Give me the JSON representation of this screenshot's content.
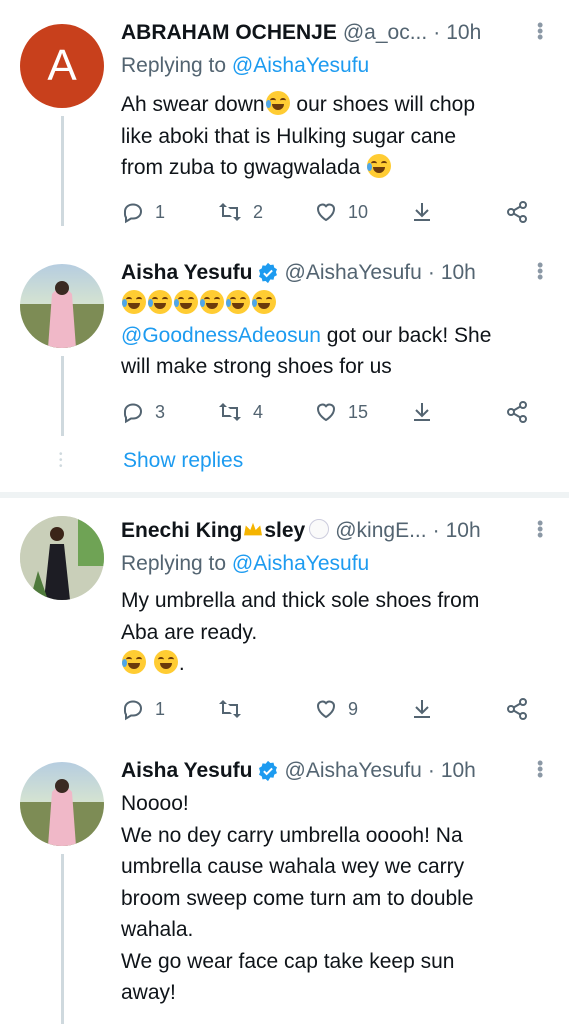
{
  "tweets": [
    {
      "name": "ABRAHAM OCHENJE",
      "handle": "@a_oc...",
      "time": "10h",
      "avatar_letter": "A",
      "replying_prefix": "Replying to ",
      "replying_to": "@AishaYesufu",
      "text_1": "Ah swear down",
      "text_2": " our shoes will chop",
      "text_3": "like aboki that is Hulking sugar cane",
      "text_4": "from zuba to gwagwalada ",
      "replies": "1",
      "retweets": "2",
      "likes": "10"
    },
    {
      "name": "Aisha Yesufu",
      "handle": "@AishaYesufu",
      "time": "10h",
      "mention": "@GoodnessAdeosun",
      "text_1": " got our back! She",
      "text_2": "will make strong shoes for us",
      "replies": "3",
      "retweets": "4",
      "likes": "15"
    },
    {
      "name_part1": "Enechi King",
      "name_part2": "sley",
      "handle": "@kingE...",
      "time": "10h",
      "replying_prefix": "Replying to ",
      "replying_to": "@AishaYesufu",
      "text_1": "My umbrella and thick sole shoes from",
      "text_2": "Aba are ready.",
      "text_3": ".",
      "replies": "1",
      "retweets": "",
      "likes": "9"
    },
    {
      "name": "Aisha Yesufu",
      "handle": "@AishaYesufu",
      "time": "10h",
      "lines": [
        "Noooo!",
        "We no dey carry umbrella ooooh! Na",
        "umbrella cause wahala wey we carry",
        "broom sweep come turn am to double",
        "wahala.",
        "We go wear face cap take keep sun",
        "away!"
      ]
    }
  ],
  "show_replies": "Show replies",
  "separator": "·",
  "colors": {
    "link": "#1d9bf0",
    "muted": "#536471",
    "avatar_a": "#c8401c",
    "verified": "#1d9bf0"
  },
  "icons": [
    "reply-icon",
    "retweet-icon",
    "like-icon",
    "share-icon",
    "more-icon",
    "verified-icon"
  ]
}
